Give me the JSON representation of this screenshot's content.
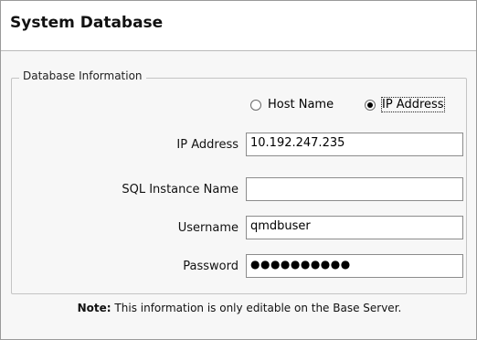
{
  "header": {
    "title": "System Database"
  },
  "group": {
    "legend": "Database Information"
  },
  "address_mode": {
    "options": [
      {
        "label": "Host Name",
        "selected": false
      },
      {
        "label": "IP Address",
        "selected": true
      }
    ]
  },
  "fields": {
    "ip_address": {
      "label": "IP Address",
      "value": "10.192.247.235"
    },
    "sql_instance": {
      "label": "SQL Instance Name",
      "value": ""
    },
    "username": {
      "label": "Username",
      "value": "qmdbuser"
    },
    "password": {
      "label": "Password",
      "value": "●●●●●●●●●●"
    }
  },
  "note": {
    "prefix": "Note:",
    "text": " This information is only editable on the Base Server."
  }
}
